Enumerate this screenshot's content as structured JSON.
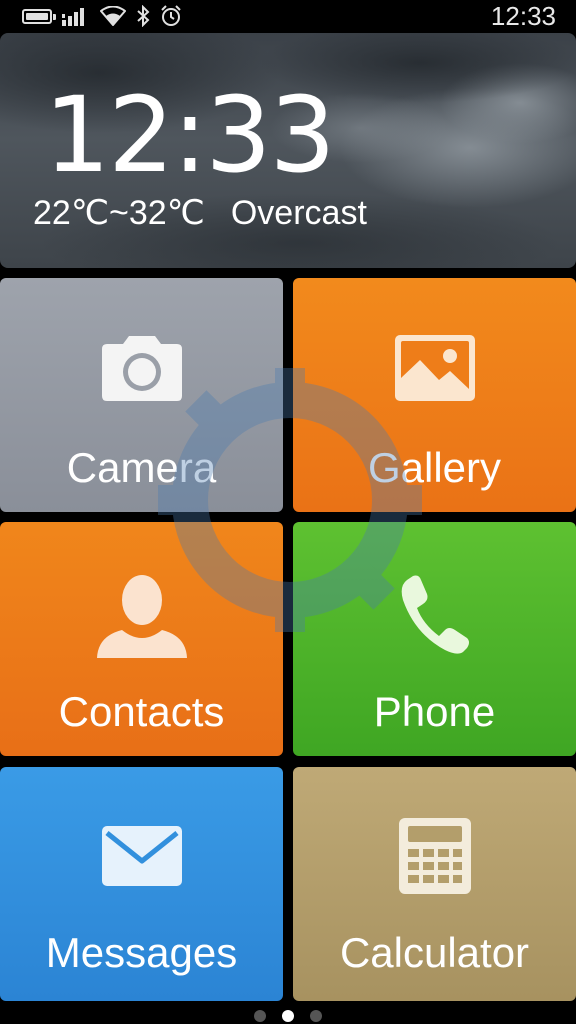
{
  "status_bar": {
    "time": "12:33",
    "icons": [
      "battery-icon",
      "signal-icon",
      "wifi-icon",
      "bluetooth-icon",
      "alarm-icon"
    ]
  },
  "clock_widget": {
    "time": "12:33",
    "temperature_range": "22℃~32℃",
    "condition": "Overcast"
  },
  "tiles": [
    {
      "label": "Camera",
      "icon": "camera-icon",
      "color": "#959aa3"
    },
    {
      "label": "Gallery",
      "icon": "gallery-icon",
      "color": "#ee7d19"
    },
    {
      "label": "Contacts",
      "icon": "contacts-icon",
      "color": "#ec7b19"
    },
    {
      "label": "Phone",
      "icon": "phone-icon",
      "color": "#4db42a"
    },
    {
      "label": "Messages",
      "icon": "messages-icon",
      "color": "#3290dd"
    },
    {
      "label": "Calculator",
      "icon": "calculator-icon",
      "color": "#b39e6b"
    }
  ],
  "pager": {
    "pages": 3,
    "current": 2
  }
}
